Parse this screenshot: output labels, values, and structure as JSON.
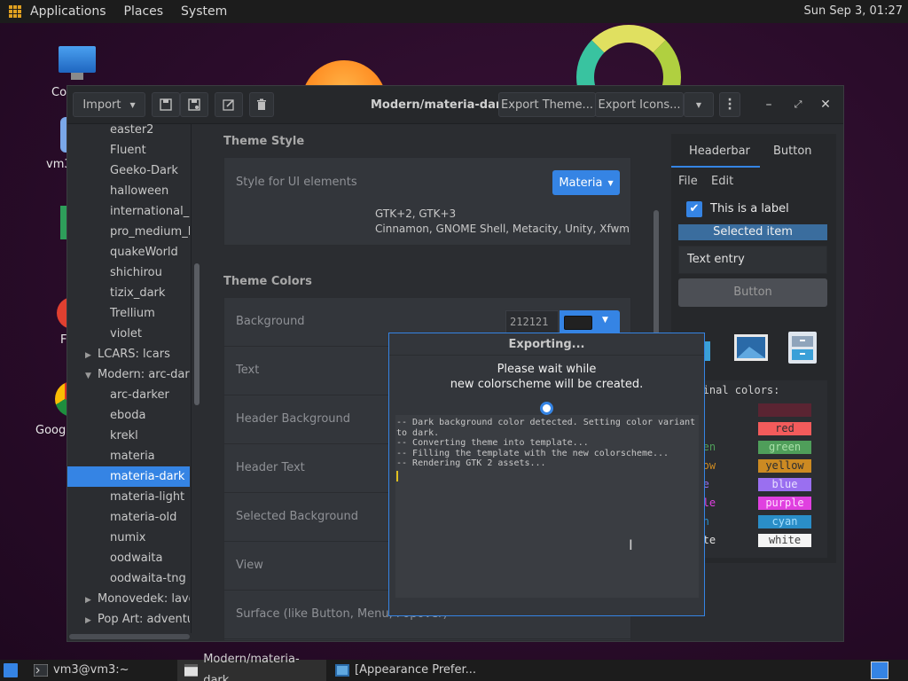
{
  "top_panel": {
    "menus": [
      "Applications",
      "Places",
      "System"
    ],
    "clock": "Sun Sep  3, 01:27"
  },
  "desktop": {
    "icon_labels": [
      "Co",
      "vm3",
      "F",
      "Goog"
    ]
  },
  "window": {
    "title": "Modern/materia-dark",
    "import_label": "Import",
    "export_theme_label": "Export Theme...",
    "export_icons_label": "Export Icons..."
  },
  "theme_list": {
    "items": [
      {
        "label": "easter2",
        "level": 2,
        "arrow": ""
      },
      {
        "label": "Fluent",
        "level": 2,
        "arrow": ""
      },
      {
        "label": "Geeko-Dark",
        "level": 2,
        "arrow": ""
      },
      {
        "label": "halloween",
        "level": 2,
        "arrow": ""
      },
      {
        "label": "international_a",
        "level": 2,
        "arrow": ""
      },
      {
        "label": "pro_medium_l",
        "level": 2,
        "arrow": ""
      },
      {
        "label": "quakeWorld",
        "level": 2,
        "arrow": ""
      },
      {
        "label": "shichirou",
        "level": 2,
        "arrow": ""
      },
      {
        "label": "tizix_dark",
        "level": 2,
        "arrow": ""
      },
      {
        "label": "Trellium",
        "level": 2,
        "arrow": ""
      },
      {
        "label": "violet",
        "level": 2,
        "arrow": ""
      },
      {
        "label": "LCARS: lcars",
        "level": 1,
        "arrow": "▶"
      },
      {
        "label": "Modern: arc-dark",
        "level": 1,
        "arrow": "▼"
      },
      {
        "label": "arc-darker",
        "level": 2,
        "arrow": ""
      },
      {
        "label": "eboda",
        "level": 2,
        "arrow": ""
      },
      {
        "label": "krekl",
        "level": 2,
        "arrow": ""
      },
      {
        "label": "materia",
        "level": 2,
        "arrow": ""
      },
      {
        "label": "materia-dark",
        "level": 2,
        "arrow": "",
        "selected": true
      },
      {
        "label": "materia-light",
        "level": 2,
        "arrow": ""
      },
      {
        "label": "materia-old",
        "level": 2,
        "arrow": ""
      },
      {
        "label": "numix",
        "level": 2,
        "arrow": ""
      },
      {
        "label": "oodwaita",
        "level": 2,
        "arrow": ""
      },
      {
        "label": "oodwaita-tng",
        "level": 2,
        "arrow": ""
      },
      {
        "label": "Monovedek: laver",
        "level": 1,
        "arrow": "▶"
      },
      {
        "label": "Pop Art: adventur",
        "level": 1,
        "arrow": "▶"
      }
    ]
  },
  "settings": {
    "theme_style_title": "Theme Style",
    "style_label": "Style for UI elements",
    "style_value": "Materia",
    "support_line1": "GTK+2, GTK+3",
    "support_line2": "Cinnamon, GNOME Shell, Metacity, Unity, Xfwm",
    "theme_colors_title": "Theme Colors",
    "color_rows": [
      "Background",
      "Text",
      "Header Background",
      "Header Text",
      "Selected Background",
      "View",
      "Surface (like Button, Menu, Popover)"
    ],
    "background_hex": "212121"
  },
  "preview": {
    "tab_headerbar": "Headerbar",
    "tab_button": "Button",
    "menu_file": "File",
    "menu_edit": "Edit",
    "check_label": "This is a label",
    "selected_item": "Selected item",
    "text_entry": "Text entry",
    "button_label": "Button",
    "terminal_title": "erminal colors:",
    "terminal_rows": [
      {
        "name": "",
        "swatch": "",
        "bg": "#5a2432",
        "fg": "#c23a4a",
        "name_color": "#c23a4a"
      },
      {
        "name": "red",
        "swatch": "red",
        "bg": "#f35b5b",
        "fg": "#2b2d31",
        "name_color": "#f35b5b"
      },
      {
        "name": "green",
        "swatch": "green",
        "bg": "#4f9e5a",
        "fg": "#a8e0a8",
        "name_color": "#4f9e5a"
      },
      {
        "name": "ellow",
        "swatch": "yellow",
        "bg": "#cc8a22",
        "fg": "#2b2d31",
        "name_color": "#cc8a22"
      },
      {
        "name": "blue",
        "swatch": "blue",
        "bg": "#9a6ff0",
        "fg": "#e8e0ff",
        "name_color": "#9a6ff0"
      },
      {
        "name": "urple",
        "swatch": "purple",
        "bg": "#e040e0",
        "fg": "#ffe0ff",
        "name_color": "#e040e0"
      },
      {
        "name": "cyan",
        "swatch": "cyan",
        "bg": "#2a8ec8",
        "fg": "#a8e0ff",
        "name_color": "#2a8ec8"
      },
      {
        "name": "white",
        "swatch": "white",
        "bg": "#f4f4f4",
        "fg": "#404040",
        "name_color": "#e0e0e0"
      }
    ]
  },
  "export_dialog": {
    "title": "Exporting...",
    "message_line1": "Please wait while",
    "message_line2": "new colorscheme will be created.",
    "log_lines": [
      "-- Dark background color detected. Setting color variant",
      "to dark.",
      "-- Converting theme into template...",
      "-- Filling the template with the new colorscheme...",
      "-- Rendering GTK 2 assets..."
    ]
  },
  "taskbar": {
    "tasks": [
      "vm3@vm3:~",
      "Modern/materia-dark",
      "[Appearance Prefer..."
    ]
  },
  "colors": {
    "accent": "#3584e4",
    "window_bg": "#2b2d31",
    "selected_color_value": "#212121"
  }
}
